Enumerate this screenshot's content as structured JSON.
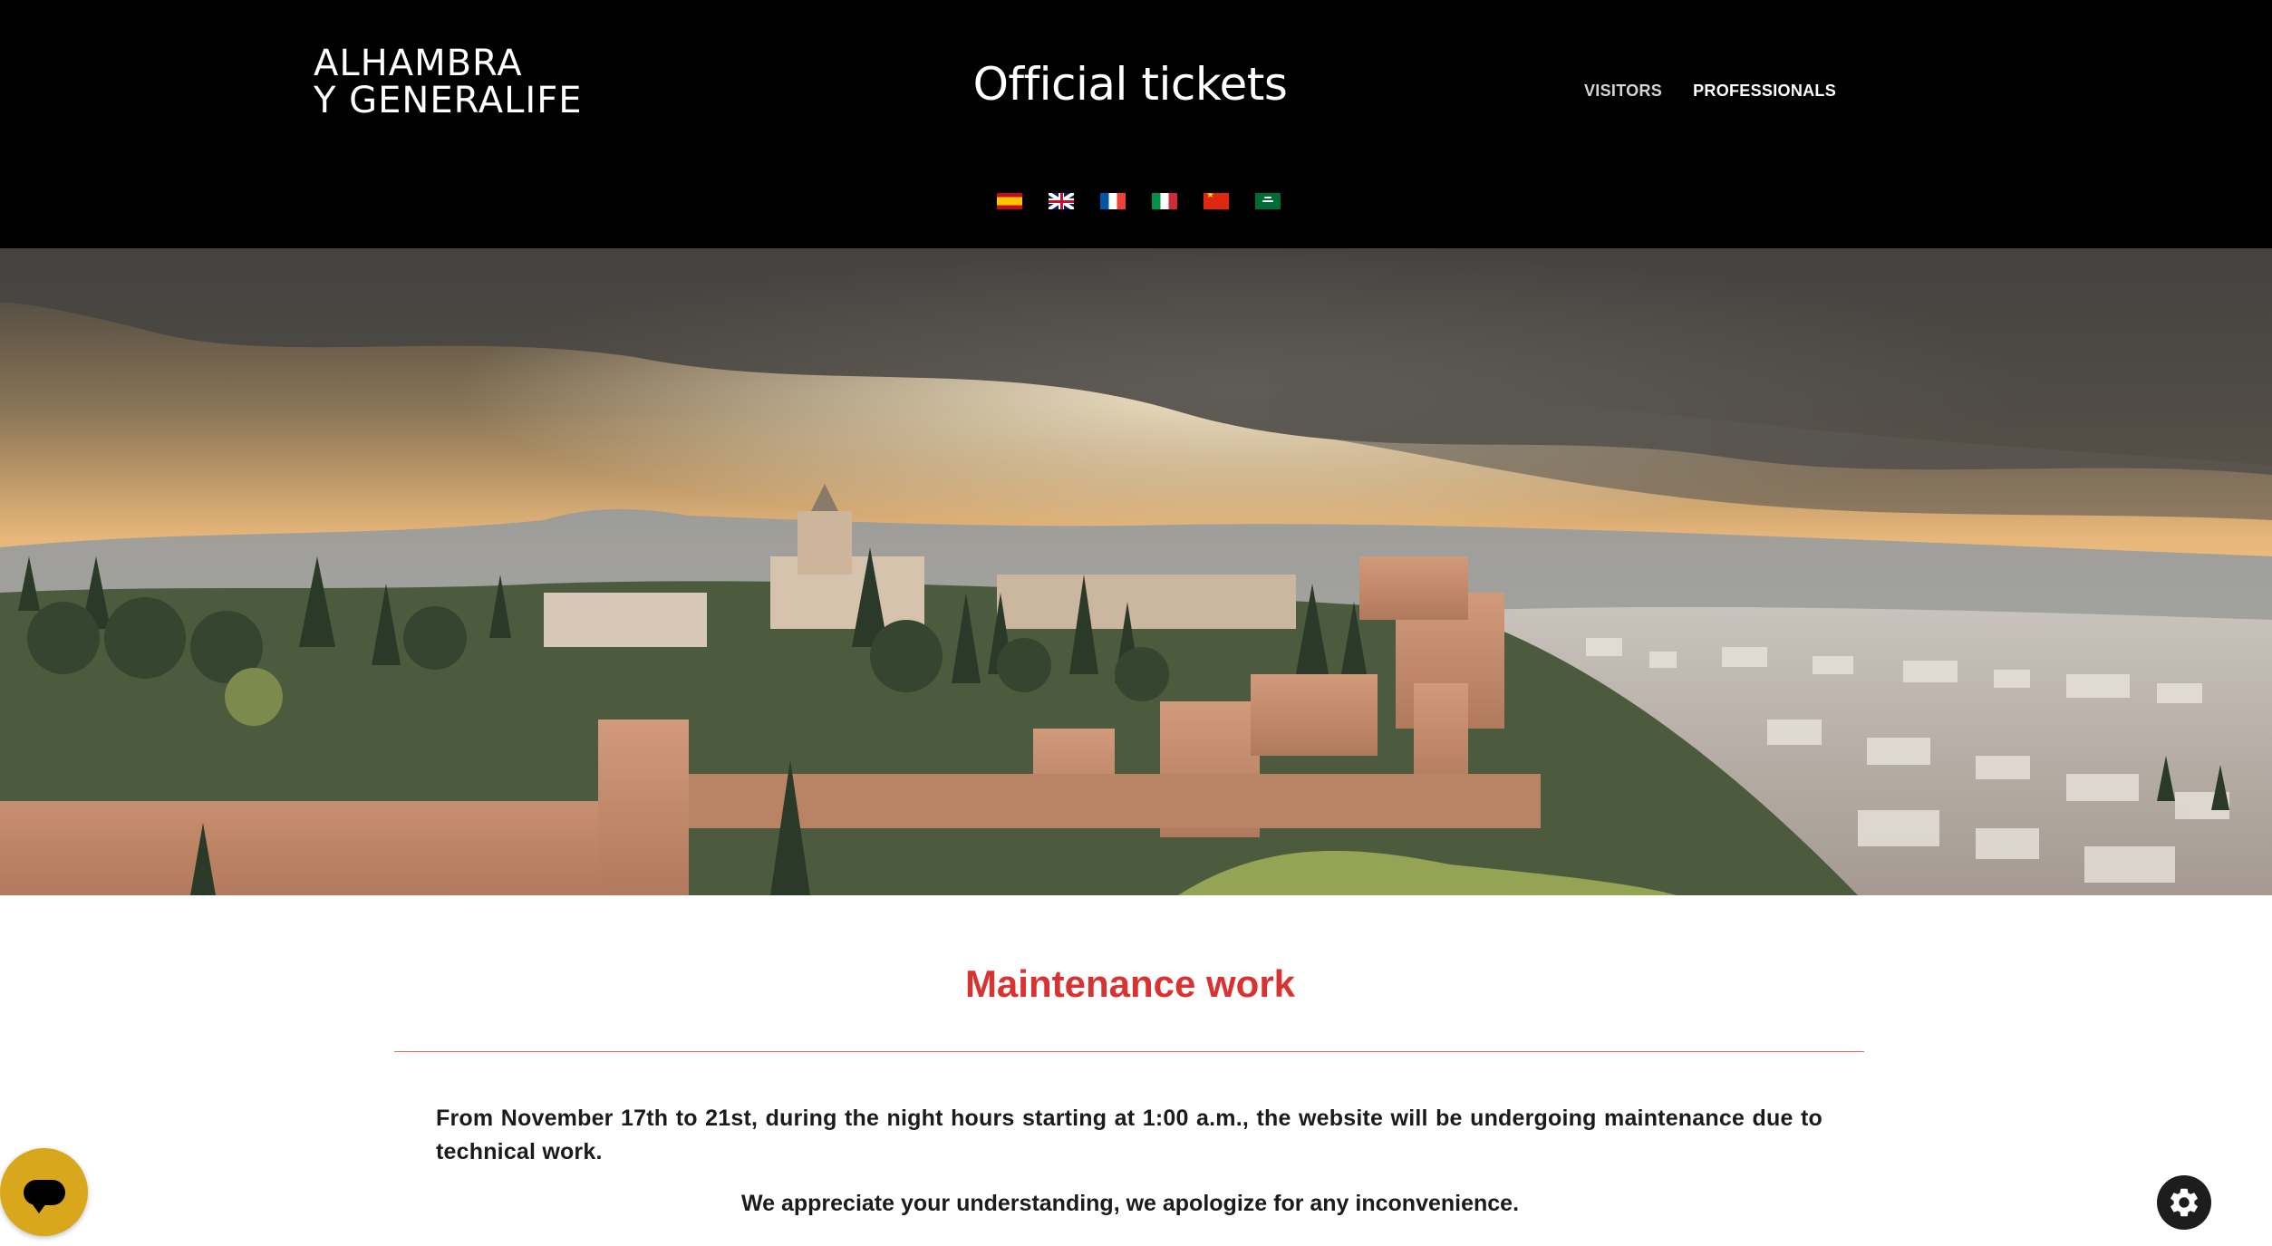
{
  "header": {
    "logo_line1": "ALHAMBRA",
    "logo_line2": "Y GENERALIFE",
    "title": "Official tickets",
    "nav": [
      {
        "label": "VISITORS",
        "active": false
      },
      {
        "label": "PROFESSIONALS",
        "active": true
      }
    ],
    "languages": [
      "es-flag-icon",
      "gb-flag-icon",
      "fr-flag-icon",
      "it-flag-icon",
      "cn-flag-icon",
      "sa-flag-icon"
    ]
  },
  "hero": {
    "image": "alhambra-panorama-sunset"
  },
  "notice": {
    "title": "Maintenance work",
    "body": "From November 17th to 21st, during the night hours starting at 1:00 a.m., the website will be undergoing maintenance due to technical work.",
    "apology": "We appreciate your understanding, we apologize for any inconvenience."
  },
  "widgets": {
    "chat": "chat-bubble-icon",
    "settings": "gear-icon"
  },
  "colors": {
    "header_bg": "#000000",
    "accent_red": "#d93331",
    "chat_yellow": "#d9a71c",
    "gear_bg": "#1d1d1d"
  }
}
